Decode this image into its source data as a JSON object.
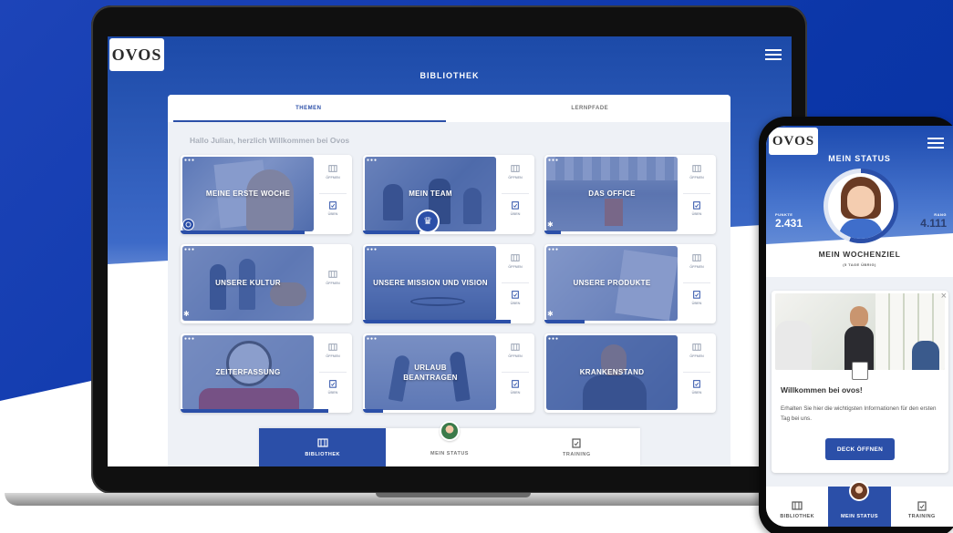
{
  "laptop": {
    "logo": "OVOS",
    "page_title": "BIBLIOTHEK",
    "tabs": [
      {
        "label": "THEMEN",
        "active": true
      },
      {
        "label": "LERNPFADE",
        "active": false
      }
    ],
    "greeting": "Hallo Julian, herzlich Willkommen bei Ovos",
    "cards": [
      {
        "title": "MEINE ERSTE WOCHE",
        "progress": 0.93,
        "open_label": "ÖFFNEN",
        "test_label": "ÜBEN",
        "badge": "refresh-icon"
      },
      {
        "title": "MEIN TEAM",
        "progress": 0.42,
        "open_label": "ÖFFNEN",
        "test_label": "ÜBEN",
        "badge": "trophy-icon"
      },
      {
        "title": "DAS OFFICE",
        "progress": 0.12,
        "open_label": "ÖFFNEN",
        "test_label": "ÜBEN",
        "badge": "sun-icon"
      },
      {
        "title": "UNSERE KULTUR",
        "progress": 0.0,
        "open_label": "ÖFFNEN",
        "badge": "sun-icon"
      },
      {
        "title": "UNSERE MISSION UND VISION",
        "progress": 0.9,
        "open_label": "ÖFFNEN",
        "test_label": "ÜBEN"
      },
      {
        "title": "UNSERE PRODUKTE",
        "progress": 0.27,
        "open_label": "ÖFFNEN",
        "test_label": "ÜBEN",
        "badge": "sun-icon"
      },
      {
        "title": "ZEITERFASSUNG",
        "progress": 0.93,
        "open_label": "ÖFFNEN",
        "test_label": "ÜBEN"
      },
      {
        "title": "URLAUB BEANTRAGEN",
        "progress": 0.15,
        "open_label": "ÖFFNEN",
        "test_label": "ÜBEN"
      },
      {
        "title": "KRANKENSTAND",
        "progress": 0.0,
        "open_label": "ÖFFNEN",
        "test_label": "ÜBEN"
      }
    ],
    "bottom_nav": [
      {
        "label": "BIBLIOTHEK",
        "active": true
      },
      {
        "label": "MEIN STATUS",
        "active": false
      },
      {
        "label": "TRAINING",
        "active": false
      }
    ]
  },
  "phone": {
    "logo": "OVOS",
    "title": "MEIN STATUS",
    "points_label": "PUNKTE",
    "points_value": "2.431",
    "rank_label": "RANG",
    "rank_value": "4.111",
    "goal_title": "MEIN WOCHENZIEL",
    "goal_sub": "(5 TAGE ÜBRIG)",
    "goal_progress": 0.55,
    "card_heading": "Willkommen bei ovos!",
    "card_text": "Erhalten Sie hier die wichtigsten Informationen für den ersten Tag bei uns.",
    "card_button": "DECK ÖFFNEN",
    "bottom_nav": [
      {
        "label": "BIBLIOTHEK",
        "active": false
      },
      {
        "label": "MEIN STATUS",
        "active": true
      },
      {
        "label": "TRAINING",
        "active": false
      }
    ]
  },
  "colors": {
    "primary": "#2b4fa8",
    "background_blue": "#0e3cae"
  }
}
